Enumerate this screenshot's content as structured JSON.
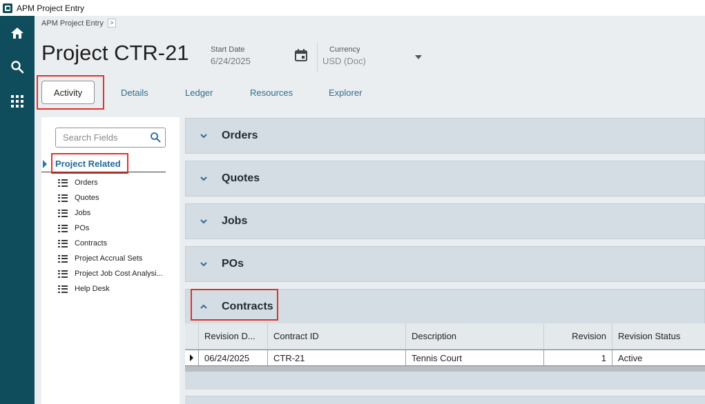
{
  "window": {
    "title": "APM Project Entry"
  },
  "nav": {
    "items": [
      {
        "name": "home",
        "icon": "home-icon"
      },
      {
        "name": "search",
        "icon": "search-icon"
      },
      {
        "name": "apps",
        "icon": "grid-icon"
      }
    ]
  },
  "breadcrumb": {
    "label": "APM Project Entry",
    "arrow": ">"
  },
  "header": {
    "title": "Project CTR-21",
    "start_date": {
      "label": "Start Date",
      "value": "6/24/2025"
    },
    "currency": {
      "label": "Currency",
      "value": "USD (Doc)"
    }
  },
  "tabs": [
    {
      "label": "Activity",
      "active": true
    },
    {
      "label": "Details"
    },
    {
      "label": "Ledger"
    },
    {
      "label": "Resources"
    },
    {
      "label": "Explorer"
    }
  ],
  "sidebar": {
    "search_placeholder": "Search Fields",
    "group_label": "Project Related",
    "items": [
      {
        "label": "Orders"
      },
      {
        "label": "Quotes"
      },
      {
        "label": "Jobs"
      },
      {
        "label": "POs"
      },
      {
        "label": "Contracts"
      },
      {
        "label": "Project Accrual Sets"
      },
      {
        "label": "Project Job Cost Analysi..."
      },
      {
        "label": "Help Desk"
      }
    ]
  },
  "sections": [
    {
      "title": "Orders",
      "expanded": false
    },
    {
      "title": "Quotes",
      "expanded": false
    },
    {
      "title": "Jobs",
      "expanded": false
    },
    {
      "title": "POs",
      "expanded": false
    },
    {
      "title": "Contracts",
      "expanded": true
    }
  ],
  "contracts_grid": {
    "columns": [
      "Revision D...",
      "Contract ID",
      "Description",
      "Revision",
      "Revision Status"
    ],
    "rows": [
      [
        "06/24/2025",
        "CTR-21",
        "Tennis Court",
        "1",
        "Active"
      ]
    ]
  },
  "colors": {
    "nav_bg": "#0f4d5c",
    "accent_link": "#2d6d8a",
    "section_bg": "#d3dde3",
    "highlight": "#e0302a"
  }
}
